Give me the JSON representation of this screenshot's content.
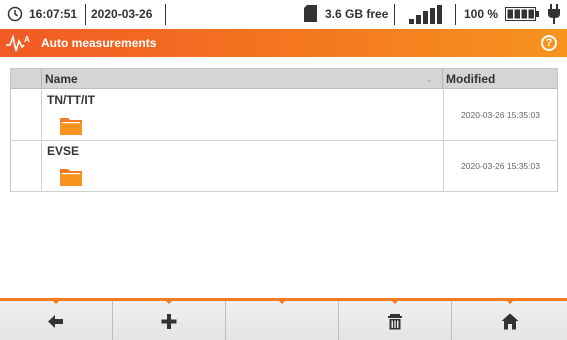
{
  "status_bar": {
    "time": "16:07:51",
    "date": "2020-03-26",
    "storage_free": "3.6 GB free",
    "battery_percent": "100 %",
    "icons": [
      "clock-icon",
      "sd-card-icon",
      "signal-strength-icon",
      "battery-icon",
      "power-plug-icon"
    ]
  },
  "title_bar": {
    "title": "Auto measurements",
    "help_symbol": "?",
    "accent_color": "#f47b20"
  },
  "file_table": {
    "columns": [
      "Name",
      "Modified"
    ],
    "rows": [
      {
        "name": "TN/TT/IT",
        "modified": "2020-03-26 15:35:03",
        "type": "folder"
      },
      {
        "name": "EVSE",
        "modified": "2020-03-26 15:35:03",
        "type": "folder"
      }
    ]
  },
  "toolbar": {
    "buttons": [
      "back-arrow-icon",
      "add-plus-icon",
      "empty",
      "trash-icon",
      "home-icon"
    ]
  }
}
